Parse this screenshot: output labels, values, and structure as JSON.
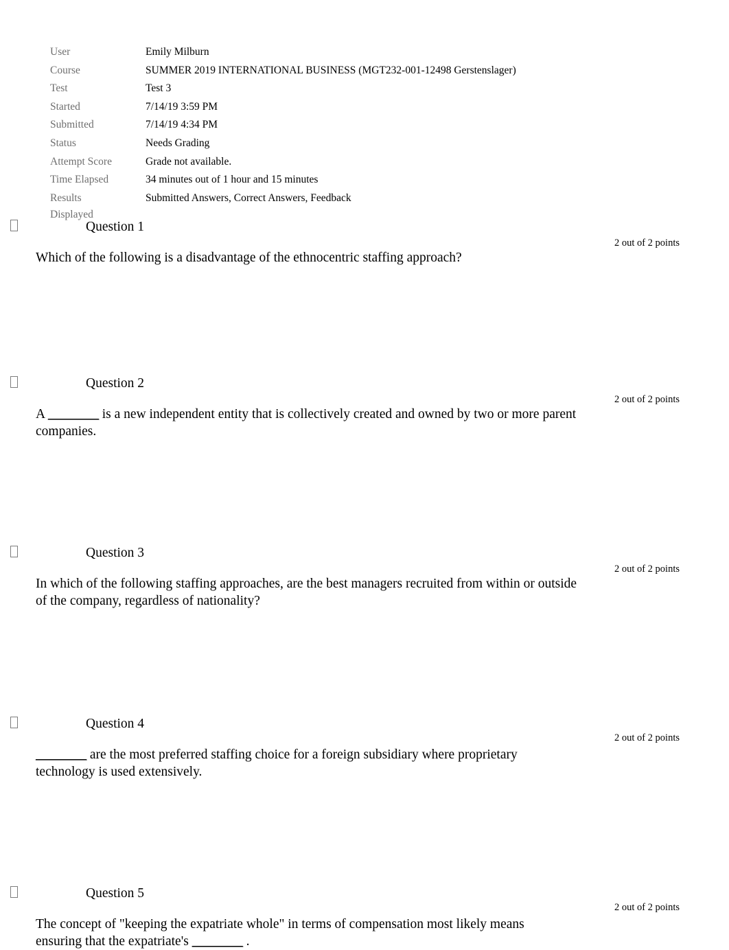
{
  "attempt_info": {
    "rows": [
      {
        "label": "User",
        "value": "Emily Milburn"
      },
      {
        "label": "Course",
        "value": "SUMMER 2019 INTERNATIONAL BUSINESS (MGT232-001-12498 Gerstenslager)"
      },
      {
        "label": "Test",
        "value": "Test 3"
      },
      {
        "label": "Started",
        "value": "7/14/19 3:59 PM"
      },
      {
        "label": "Submitted",
        "value": "7/14/19 4:34 PM"
      },
      {
        "label": "Status",
        "value": "Needs Grading"
      },
      {
        "label": "Attempt Score",
        "value": "Grade not available."
      },
      {
        "label": "Time Elapsed",
        "value": "34 minutes out of 1 hour and 15 minutes"
      },
      {
        "label": "Results Displayed",
        "value": "Submitted Answers, Correct Answers, Feedback"
      }
    ]
  },
  "questions": [
    {
      "marker_icon": "correct-answer-marker-icon",
      "title": "Question 1",
      "points": "2 out of 2 points",
      "text": "Which of the following is a disadvantage of the ethnocentric staffing approach?"
    },
    {
      "marker_icon": "correct-answer-marker-icon",
      "title": "Question 2",
      "points": "2 out of 2 points",
      "text_pre": "A ",
      "blank": "________",
      "text_post": " is a new independent entity that is collectively created and owned by two or more parent companies."
    },
    {
      "marker_icon": "correct-answer-marker-icon",
      "title": "Question 3",
      "points": "2 out of 2 points",
      "text": "In which of the following staffing approaches, are the best managers recruited from within or outside of the company, regardless of nationality?"
    },
    {
      "marker_icon": "correct-answer-marker-icon",
      "title": "Question 4",
      "points": "2 out of 2 points",
      "text_pre": "",
      "blank": "________",
      "text_post": " are the most preferred staffing choice for a foreign subsidiary where proprietary technology is used extensively."
    },
    {
      "marker_icon": "correct-answer-marker-icon",
      "title": "Question 5",
      "points": "2 out of 2 points",
      "text_pre": "The concept of \"keeping the expatriate whole\" in terms of compensation most likely means ensuring that the expatriate's ",
      "blank": "________",
      "text_post": " ."
    }
  ]
}
